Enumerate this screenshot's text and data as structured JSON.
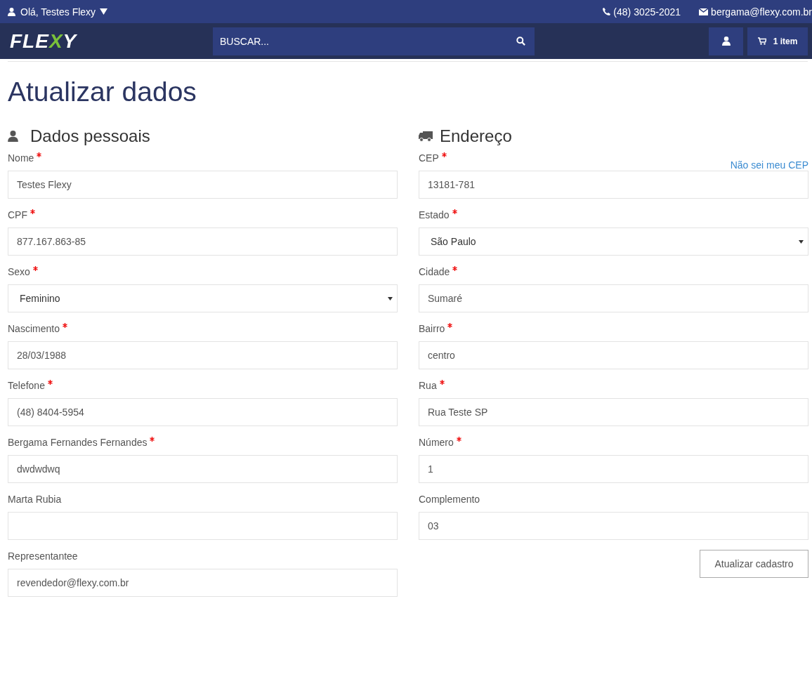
{
  "top_bar": {
    "greeting": "Olá, Testes Flexy",
    "phone": "(48) 3025-2021",
    "email": "bergama@flexy.com.br"
  },
  "header": {
    "logo": "FLEXY",
    "search": {
      "placeholder": "BUSCAR..."
    },
    "cart": "1 item"
  },
  "title": "Atualizar dados",
  "personal": {
    "heading": "Dados pessoais",
    "fields": [
      {
        "label": "Nome",
        "required": true,
        "kind": "text",
        "value": "Testes Flexy"
      },
      {
        "label": "CPF",
        "required": true,
        "kind": "text",
        "value": "877.167.863-85"
      },
      {
        "label": "Sexo",
        "required": true,
        "kind": "select",
        "value": "Feminino"
      },
      {
        "label": "Nascimento",
        "required": true,
        "kind": "text",
        "value": "28/03/1988"
      },
      {
        "label": "Telefone",
        "required": true,
        "kind": "text",
        "value": "(48) 8404-5954"
      },
      {
        "label": "Bergama Fernandes Fernandes",
        "required": true,
        "kind": "text",
        "value": "dwdwdwq"
      },
      {
        "label": "Marta Rubia",
        "required": false,
        "kind": "text"
      },
      {
        "label": "Representantee",
        "required": false,
        "kind": "text",
        "value": "revendedor@flexy.com.br"
      }
    ]
  },
  "address": {
    "heading": "Endereço",
    "cep_help_link": "Não sei meu CEP",
    "fields": [
      {
        "label": "CEP",
        "required": true,
        "kind": "text",
        "value": "13181-781"
      },
      {
        "label": "Estado",
        "required": true,
        "kind": "select",
        "value": "São Paulo"
      },
      {
        "label": "Cidade",
        "required": true,
        "kind": "text",
        "value": "Sumaré"
      },
      {
        "label": "Bairro",
        "required": true,
        "kind": "text",
        "value": "centro"
      },
      {
        "label": "Rua",
        "required": true,
        "kind": "text",
        "value": "Rua Teste SP"
      },
      {
        "label": "Número",
        "required": true,
        "kind": "text",
        "value": "1"
      },
      {
        "label": "Complemento",
        "required": false,
        "kind": "text",
        "value": "03"
      }
    ],
    "submit": "Atualizar cadastro"
  }
}
